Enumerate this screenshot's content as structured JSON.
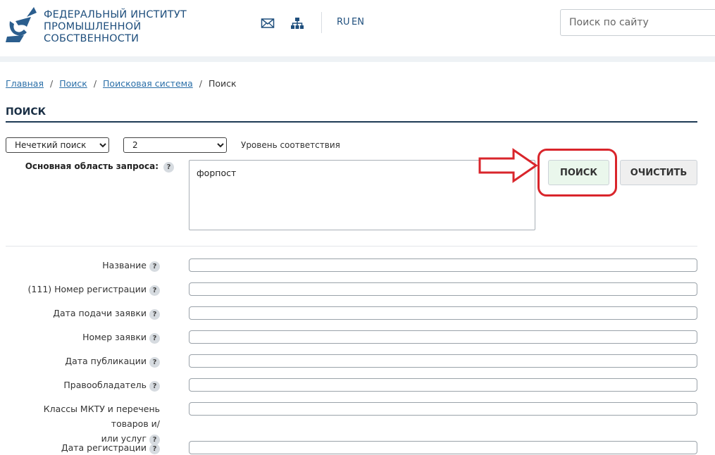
{
  "header": {
    "org_line1": "ФЕДЕРАЛЬНЫЙ ИНСТИТУТ",
    "org_line2": "ПРОМЫШЛЕННОЙ",
    "org_line3": "СОБСТВЕННОСТИ",
    "mail_icon": "envelope-icon",
    "sitemap_icon": "sitemap-icon",
    "lang_ru": "RU",
    "lang_en": "EN",
    "search_placeholder": "Поиск по сайту",
    "brand_color": "#1f4f7d"
  },
  "breadcrumb": {
    "items": [
      "Главная",
      "Поиск",
      "Поисковая система"
    ],
    "current": "Поиск",
    "separator": "/"
  },
  "page": {
    "title": "ПОИСК"
  },
  "search_form": {
    "mode_selected": "Нечеткий поиск",
    "level_selected": "2",
    "level_label": "Уровень соответствия",
    "main_label": "Основная область запроса:",
    "help": "?",
    "main_query": "форпост",
    "search_button": "ПОИСК",
    "clear_button": "ОЧИСТИТЬ",
    "highlight_color": "#d9252b"
  },
  "fields": [
    {
      "label": "Название"
    },
    {
      "label": "(111) Номер регистрации"
    },
    {
      "label": "Дата подачи заявки"
    },
    {
      "label": "Номер заявки"
    },
    {
      "label": "Дата публикации"
    },
    {
      "label": "Правообладатель"
    },
    {
      "label_line1": "Классы МКТУ и перечень товаров и/",
      "label_line2": "или услуг"
    },
    {
      "label": "Дата регистрации"
    }
  ]
}
